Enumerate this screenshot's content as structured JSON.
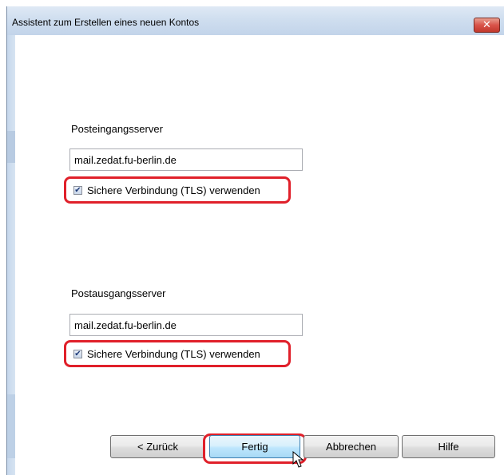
{
  "window": {
    "title": "Assistent zum Erstellen eines neuen Kontos",
    "close_icon": "close-icon",
    "accent_color": "#e0202a"
  },
  "incoming": {
    "label": "Posteingangsserver",
    "value": "mail.zedat.fu-berlin.de",
    "tls_label": "Sichere Verbindung (TLS) verwenden",
    "tls_checked": true
  },
  "outgoing": {
    "label": "Postausgangsserver",
    "value": "mail.zedat.fu-berlin.de",
    "tls_label": "Sichere Verbindung (TLS) verwenden",
    "tls_checked": true
  },
  "buttons": {
    "back": "< Zurück",
    "finish": "Fertig",
    "cancel": "Abbrechen",
    "help": "Hilfe"
  }
}
